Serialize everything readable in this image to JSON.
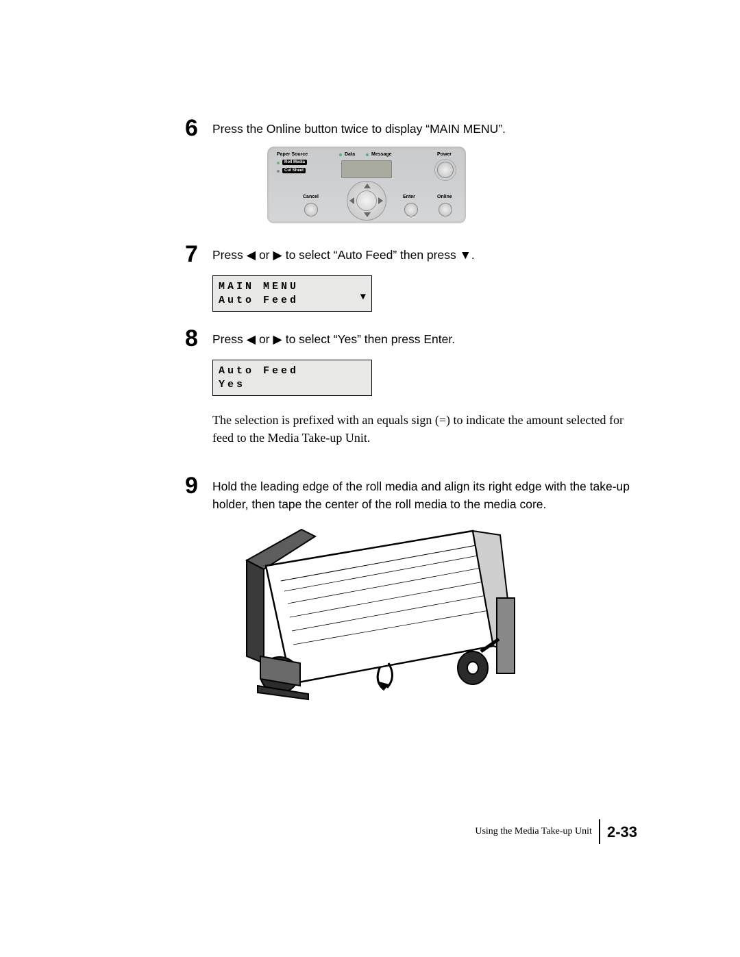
{
  "steps": {
    "s6": {
      "num": "6",
      "text_a": "Press the Online button twice to display “MAIN MENU”."
    },
    "s7": {
      "num": "7",
      "text_a": "Press ",
      "text_b": " or ",
      "text_c": " to select “Auto Feed” then press ",
      "text_d": "."
    },
    "s8": {
      "num": "8",
      "text_a": "Press ",
      "text_b": " or ",
      "text_c": " to select “Yes” then press Enter."
    },
    "s9": {
      "num": "9",
      "text": "Hold the leading edge of the roll media and align its right edge with the take-up holder, then tape the center of the roll media to the media core."
    }
  },
  "glyphs": {
    "left": "◀",
    "right": "▶",
    "down": "▼"
  },
  "lcd1": {
    "line1": "MAIN MENU",
    "line2": "Auto Feed"
  },
  "lcd2": {
    "line1": "Auto Feed",
    "line2": "Yes"
  },
  "note": "The selection is prefixed with an equals sign (=) to indicate the amount selected for feed to the Media Take-up Unit.",
  "panel": {
    "paper_source": "Paper Source",
    "roll_media": "Roll Media",
    "cut_sheet": "Cut Sheet",
    "data": "Data",
    "message": "Message",
    "power": "Power",
    "cancel": "Cancel",
    "enter": "Enter",
    "online": "Online"
  },
  "footer": {
    "section": "Using the Media Take-up Unit",
    "page": "2-33"
  }
}
